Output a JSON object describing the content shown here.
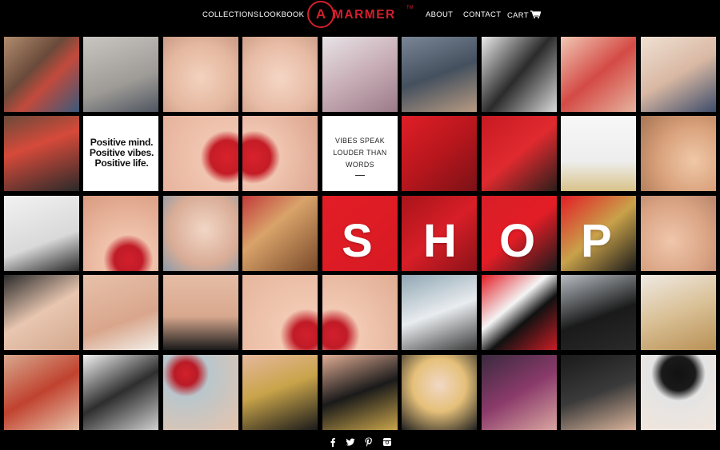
{
  "nav": {
    "collections": "COLLECTIONS",
    "lookbook": "LOOKBOOK",
    "about": "ABOUT",
    "contact": "CONTACT",
    "cart": "CART"
  },
  "logo": {
    "mark": "A",
    "word": "MARMER",
    "tm": "TM"
  },
  "tiles": {
    "positive_lines": [
      "Positive mind.",
      "Positive vibes.",
      "Positive life."
    ],
    "vibes_lines": [
      "VIBES SPEAK",
      "LOUDER THAN",
      "WORDS"
    ]
  },
  "shop": {
    "letters": [
      "S",
      "H",
      "O",
      "P"
    ]
  },
  "footer": {
    "icons": [
      "facebook-icon",
      "twitter-icon",
      "pinterest-icon",
      "instagram-icon"
    ]
  },
  "colors": {
    "brand_red": "#d21f2d",
    "background": "#000000"
  }
}
